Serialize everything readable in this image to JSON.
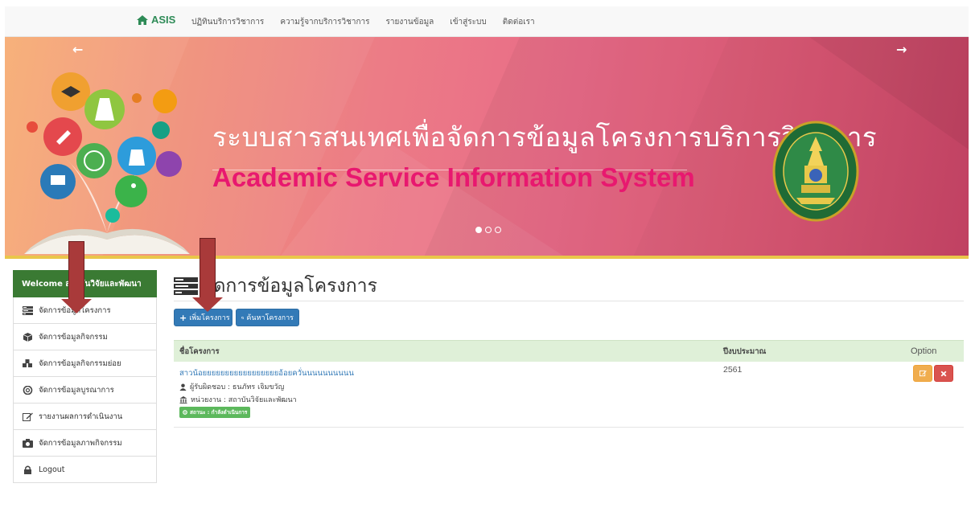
{
  "nav": {
    "brand": "ASIS",
    "items": [
      "ปฏิทินบริการวิชาการ",
      "ความรู้จากบริการวิชาการ",
      "รายงานข้อมูล",
      "เข้าสู่ระบบ",
      "ติดต่อเรา"
    ]
  },
  "banner": {
    "thai_title": "ระบบสารสนเทศเพื่อจัดการข้อมูลโครงการบริการวิชาการ",
    "eng_title": "Academic Service Information System",
    "arrow_left": "←",
    "arrow_right": "→",
    "slides_total": 3,
    "active_slide": 1,
    "seal_text": "SONGKHLA RAJABHAT UNIVERSITY",
    "colors": {
      "eng_title": "#e8186f",
      "strip": "#e9c64a"
    }
  },
  "sidebar": {
    "header": "Welcome สถาบันวิจัยและพัฒนา",
    "items": [
      {
        "label": "จัดการข้อมูลโครงการ",
        "icon": "tasks-icon"
      },
      {
        "label": "จัดการข้อมูลกิจกรรม",
        "icon": "cube-icon"
      },
      {
        "label": "จัดการข้อมูลกิจกรรมย่อย",
        "icon": "cubes-icon"
      },
      {
        "label": "จัดการข้อมูลบูรณาการ",
        "icon": "lifebuoy-icon"
      },
      {
        "label": "รายงานผลการดำเนินงาน",
        "icon": "edit-icon"
      },
      {
        "label": "จัดการข้อมูลภาพกิจกรรม",
        "icon": "camera-icon"
      },
      {
        "label": "Logout",
        "icon": "lock-icon"
      }
    ]
  },
  "main": {
    "title": "จัดการข้อมูลโครงการ",
    "add_button": "เพิ่มโครงการ",
    "search_button": "ค้นหาโครงการ",
    "table": {
      "headers": [
        "ชื่อโครงการ",
        "ปีงบประมาณ",
        "Option"
      ],
      "rows": [
        {
          "name": "สาวน้อยยยยยยยยยยยยยยยยยอ้อยควั่นนนนนนนนนน",
          "owner": "ผู้รับผิดชอบ : ธนภัทร เจิมขวัญ",
          "unit": "หน่วยงาน : สถาบันวิจัยและพัฒนา",
          "status": "สถานะ : กำลังดำเนินการ",
          "year": "2561"
        }
      ]
    }
  },
  "colors": {
    "primary": "#337ab7",
    "sidebar_header": "#3a7a33",
    "table_header": "#dff0d8",
    "warning": "#f0ad4e",
    "danger": "#d9534f",
    "success": "#5cb85c",
    "annotation_arrow": "#a93a3a"
  }
}
